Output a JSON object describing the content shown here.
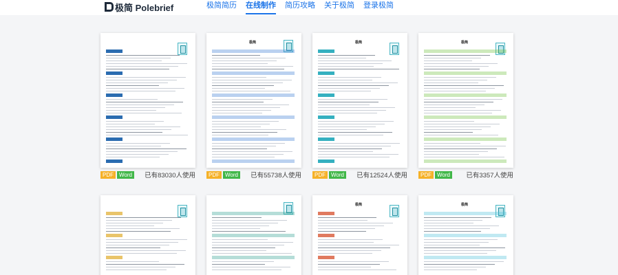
{
  "brand": {
    "logo_text": "极简 Polebrief"
  },
  "nav": {
    "items": [
      {
        "label": "极简简历",
        "active": false
      },
      {
        "label": "在线制作",
        "active": true
      },
      {
        "label": "简历攻略",
        "active": false
      },
      {
        "label": "关于极简",
        "active": false
      },
      {
        "label": "登录极简",
        "active": false
      }
    ]
  },
  "templates": [
    {
      "pdf": "PDF",
      "word": "Word",
      "usage": "已有83030人使用",
      "accent": "#2b6cb0",
      "name": ""
    },
    {
      "pdf": "PDF",
      "word": "Word",
      "usage": "已有55738人使用",
      "accent": "#3a7bd5",
      "name": "极简"
    },
    {
      "pdf": "PDF",
      "word": "Word",
      "usage": "已有12524人使用",
      "accent": "#35b0c0",
      "name": "极简"
    },
    {
      "pdf": "PDF",
      "word": "Word",
      "usage": "已有3357人使用",
      "accent": "#6fbf3b",
      "name": "极简"
    },
    {
      "name": "",
      "accent": "#e9c46a"
    },
    {
      "name": "",
      "accent": "#2a9d8f"
    },
    {
      "name": "极简",
      "accent": "#e07a5f"
    },
    {
      "name": "极简",
      "accent": "#4bc0d9"
    }
  ],
  "colors": {
    "nav_blue": "#1a73e8",
    "pdf_badge": "#f5b128",
    "word_badge": "#41b749"
  }
}
